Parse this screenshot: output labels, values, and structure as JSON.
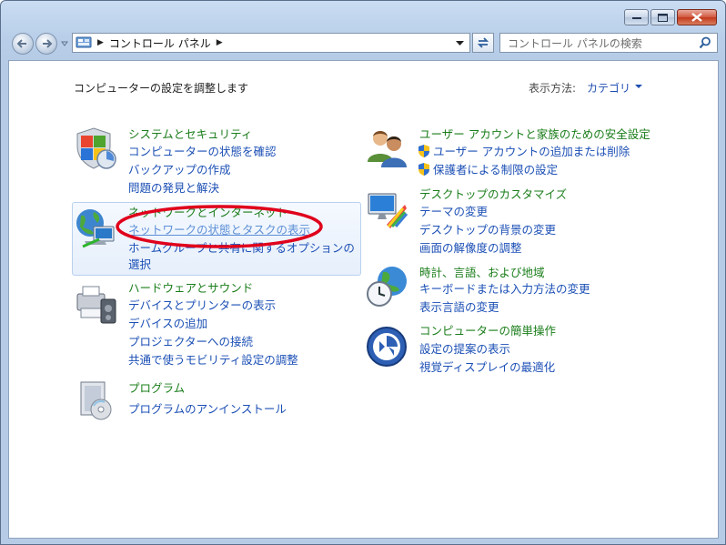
{
  "window": {
    "minimize_icon": "minimize-icon",
    "maximize_icon": "maximize-icon",
    "close_icon": "close-icon"
  },
  "nav": {
    "address_path": "コントロール パネル",
    "search_placeholder": "コントロール パネルの検索"
  },
  "header": {
    "title": "コンピューターの設定を調整します",
    "view_by_label": "表示方法:",
    "view_by_value": "カテゴリ"
  },
  "categories": {
    "system_security": {
      "title": "システムとセキュリティ",
      "links": [
        "コンピューターの状態を確認",
        "バックアップの作成",
        "問題の発見と解決"
      ]
    },
    "network": {
      "title": "ネットワークとインターネット",
      "links": [
        "ネットワークの状態とタスクの表示",
        "ホームグループと共有に関するオプションの",
        "選択"
      ]
    },
    "hardware": {
      "title": "ハードウェアとサウンド",
      "links": [
        "デバイスとプリンターの表示",
        "デバイスの追加",
        "プロジェクターへの接続",
        "共通で使うモビリティ設定の調整"
      ]
    },
    "programs": {
      "title": "プログラム",
      "links": [
        "プログラムのアンインストール"
      ]
    },
    "user_accounts": {
      "title": "ユーザー アカウントと家族のための安全設定",
      "links": [
        "ユーザー アカウントの追加または削除",
        "保護者による制限の設定"
      ]
    },
    "appearance": {
      "title": "デスクトップのカスタマイズ",
      "links": [
        "テーマの変更",
        "デスクトップの背景の変更",
        "画面の解像度の調整"
      ]
    },
    "clock": {
      "title": "時計、言語、および地域",
      "links": [
        "キーボードまたは入力方法の変更",
        "表示言語の変更"
      ]
    },
    "ease": {
      "title": "コンピューターの簡単操作",
      "links": [
        "設定の提案の表示",
        "視覚ディスプレイの最適化"
      ]
    }
  },
  "colors": {
    "category_title": "#1a7d1a",
    "link": "#1b4fb5",
    "highlight_ellipse": "#e0001b"
  }
}
